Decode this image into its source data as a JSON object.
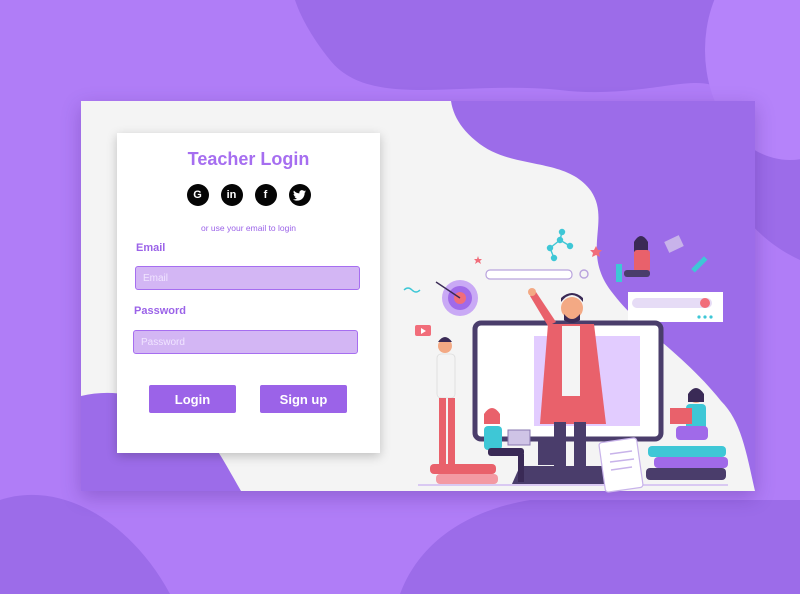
{
  "login_card": {
    "title": "Teacher Login",
    "social_buttons": [
      {
        "icon": "google-icon",
        "glyph": "G"
      },
      {
        "icon": "linkedin-icon",
        "glyph": "in"
      },
      {
        "icon": "facebook-icon",
        "glyph": "f"
      },
      {
        "icon": "twitter-icon",
        "glyph": "t"
      }
    ],
    "hint": "or use your email to login",
    "email_label": "Email",
    "email_placeholder": "Email",
    "email_value": "",
    "password_label": "Password",
    "password_placeholder": "Password",
    "password_value": "",
    "login_label": "Login",
    "signup_label": "Sign up"
  },
  "colors": {
    "background": "#b07df7",
    "background_blob": "#9c6ce9",
    "panel": "#f4f4f4",
    "accent": "#9b63e8",
    "title": "#a66ef0",
    "input_fill": "#d3b6f4"
  },
  "illustration": {
    "icons": [
      "monitor-icon",
      "target-icon",
      "youtube-play-icon",
      "molecule-icon",
      "notebook-icon",
      "book-stack-icon"
    ]
  }
}
